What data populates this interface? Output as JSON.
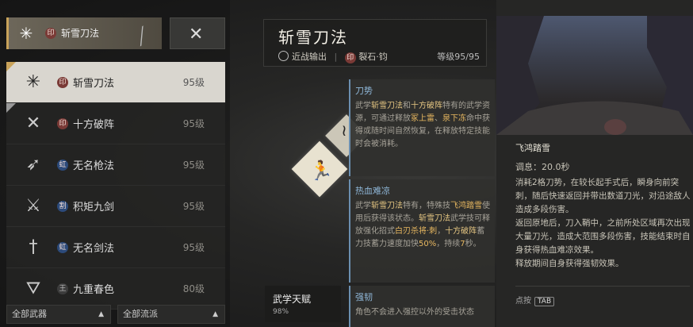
{
  "weapon_tabs": {
    "selected": {
      "name": "斩雪刀法",
      "seal": "印"
    },
    "other": {
      "icon": "crossed-blades-icon"
    }
  },
  "martial_list": [
    {
      "name": "斩雪刀法",
      "seal": "印",
      "seal_color": "red",
      "level": "95级",
      "icon": "snowflake-blade-icon",
      "selected": true,
      "badge": "gold"
    },
    {
      "name": "十方破阵",
      "seal": "印",
      "seal_color": "red",
      "level": "95级",
      "icon": "crossed-spears-icon",
      "selected": false,
      "badge": "gray"
    },
    {
      "name": "无名枪法",
      "seal": "虹",
      "seal_color": "blue",
      "level": "95级",
      "icon": "spear-icon",
      "selected": false,
      "badge": ""
    },
    {
      "name": "积矩九剑",
      "seal": "割",
      "seal_color": "blue",
      "level": "95级",
      "icon": "nine-swords-icon",
      "selected": false,
      "badge": ""
    },
    {
      "name": "无名剑法",
      "seal": "虹",
      "seal_color": "blue",
      "level": "95级",
      "icon": "sword-icon",
      "selected": false,
      "badge": ""
    },
    {
      "name": "九重春色",
      "seal": "王",
      "seal_color": "gray",
      "level": "80级",
      "icon": "fan-icon",
      "selected": false,
      "badge": ""
    }
  ],
  "filters": {
    "weapon": "全部武器",
    "school": "全部流派"
  },
  "skill": {
    "title": "斩雪刀法",
    "type": "近战输出",
    "source_seal": "印",
    "source": "裂石·钧",
    "level": "等级95/95"
  },
  "talent": {
    "label": "武学天赋",
    "progress": "98%"
  },
  "tips": [
    {
      "heading": "刀势",
      "parts": [
        "武学",
        "斩雪刀法",
        "和",
        "十方破阵",
        "特有的武学资源，可通过释放",
        "冢上雷",
        "、",
        "泉下冻",
        "命中获得或随时间自然恢复，在释放特定技能时会被消耗。"
      ]
    },
    {
      "heading": "热血难凉",
      "parts": [
        "武学",
        "斩雪刀法",
        "特有，特殊技",
        "飞鸿踏雪",
        "使用后获得该状态。",
        "斩雪刀法",
        "武学技可释放强化招式",
        "白刃杀将·刺",
        "，",
        "十方破阵",
        "蓄力技蓄力速度加快",
        "50%",
        "，持续",
        "7",
        "秒。"
      ]
    },
    {
      "heading": "强韧",
      "parts": [
        "角色不会进入强控以外的受击状态"
      ]
    }
  ],
  "detail": {
    "name": "飞鸿踏雪",
    "cooldown": "调息：20.0秒",
    "desc": "消耗2格刀势，在较长起手式后，瞬身向前突刺，随后快速返回并带出数道刀光，对沿途敌人造成多段伤害。\n返回原地后，刀入鞘中，之前所处区域再次出现大量刀光，造成大范围多段伤害，技能结束时自身获得热血难凉效果。\n释放期间自身获得强韧效果。",
    "tab_hint": "点按",
    "tab_key": "TAB"
  }
}
